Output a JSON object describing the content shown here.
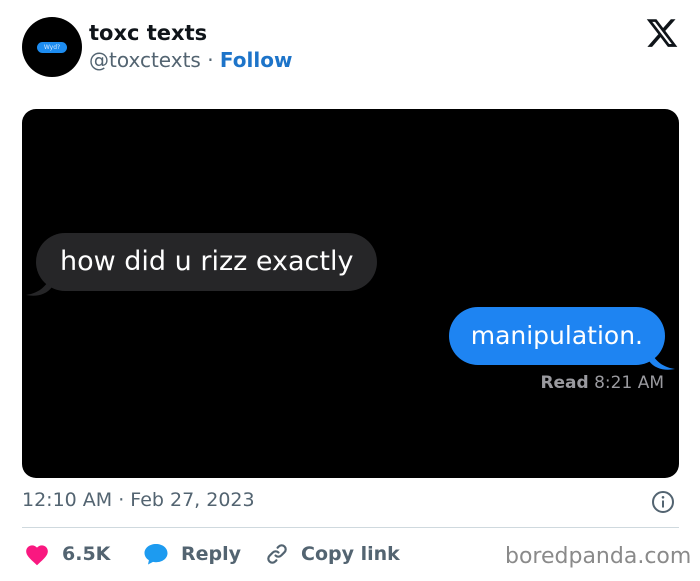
{
  "author": {
    "display_name": "toxc texts",
    "handle": "@toxctexts",
    "separator": " · ",
    "follow_label": "Follow",
    "avatar_text": "Wyd?"
  },
  "platform_icon": "x-logo-icon",
  "media": {
    "received_message": "how did u rizz exactly",
    "sent_message": "manipulation.",
    "read_label": "Read",
    "read_time": "8:21 AM",
    "colors": {
      "received_bubble": "#262628",
      "sent_bubble": "#1e84f2"
    }
  },
  "meta": {
    "timestamp": "12:10 AM · Feb 27, 2023"
  },
  "actions": {
    "likes": "6.5K",
    "reply_label": "Reply",
    "copy_label": "Copy link"
  },
  "watermark": "boredpanda.com",
  "colors": {
    "like": "#f91880",
    "reply": "#1d9bf0",
    "link": "#1d74c9",
    "muted": "#536471"
  }
}
